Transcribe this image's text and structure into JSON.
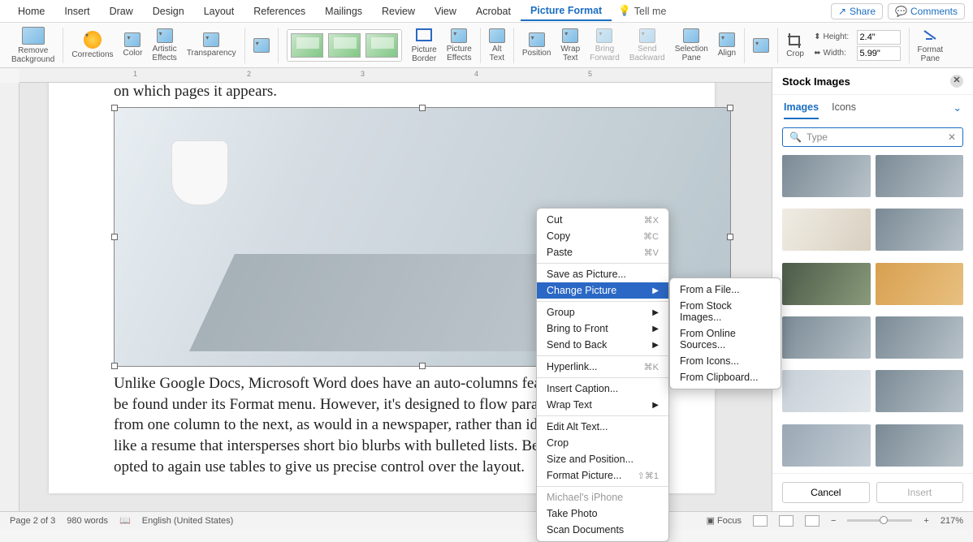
{
  "menubar": {
    "tabs": [
      "Home",
      "Insert",
      "Draw",
      "Design",
      "Layout",
      "References",
      "Mailings",
      "Review",
      "View",
      "Acrobat",
      "Picture Format"
    ],
    "active_index": 10,
    "tell_me": "Tell me",
    "share": "Share",
    "comments": "Comments"
  },
  "ribbon": {
    "remove_bg": "Remove\nBackground",
    "corrections": "Corrections",
    "color": "Color",
    "artistic": "Artistic\nEffects",
    "transparency": "Transparency",
    "picture_border": "Picture\nBorder",
    "picture_effects": "Picture\nEffects",
    "alt_text": "Alt\nText",
    "position": "Position",
    "wrap_text": "Wrap\nText",
    "bring_forward": "Bring\nForward",
    "send_backward": "Send\nBackward",
    "selection_pane": "Selection\nPane",
    "align": "Align",
    "crop": "Crop",
    "height_label": "Height:",
    "height_value": "2.4\"",
    "width_label": "Width:",
    "width_value": "5.99\"",
    "format_pane": "Format\nPane"
  },
  "document": {
    "line_before": "on which pages it appears.",
    "body": "Unlike Google Docs, Microsoft Word does have an auto-columns feature, which can be found under its Format menu. However, it's designed to flow paragraph-heavy text from one column to the next, as would in a newspaper, rather than ideal for something like a resume that intersperses short bio blurbs with bulleted lists. Because of that, we opted to again use tables to give us precise control over the layout."
  },
  "context_menu": {
    "items": [
      {
        "label": "Cut",
        "shortcut": "⌘X"
      },
      {
        "label": "Copy",
        "shortcut": "⌘C"
      },
      {
        "label": "Paste",
        "shortcut": "⌘V"
      },
      {
        "sep": true
      },
      {
        "label": "Save as Picture..."
      },
      {
        "label": "Change Picture",
        "submenu": true,
        "highlight": true
      },
      {
        "sep": true
      },
      {
        "label": "Group",
        "submenu": true
      },
      {
        "label": "Bring to Front",
        "submenu": true
      },
      {
        "label": "Send to Back",
        "submenu": true
      },
      {
        "sep": true
      },
      {
        "label": "Hyperlink...",
        "shortcut": "⌘K"
      },
      {
        "sep": true
      },
      {
        "label": "Insert Caption..."
      },
      {
        "label": "Wrap Text",
        "submenu": true
      },
      {
        "sep": true
      },
      {
        "label": "Edit Alt Text..."
      },
      {
        "label": "Crop"
      },
      {
        "label": "Size and Position..."
      },
      {
        "label": "Format Picture...",
        "shortcut": "⇧⌘1"
      },
      {
        "sep": true
      },
      {
        "label": "Michael's iPhone",
        "disabled": true
      },
      {
        "label": "Take Photo"
      },
      {
        "label": "Scan Documents"
      }
    ],
    "submenu": [
      "From a File...",
      "From Stock Images...",
      "From Online Sources...",
      "From Icons...",
      "From Clipboard..."
    ]
  },
  "panel": {
    "title": "Stock Images",
    "tabs": [
      "Images",
      "Icons"
    ],
    "active_tab": 0,
    "search_value": "Type",
    "cancel": "Cancel",
    "insert": "Insert"
  },
  "status": {
    "page": "Page 2 of 3",
    "words": "980 words",
    "lang": "English (United States)",
    "focus": "Focus",
    "zoom": "217%"
  }
}
